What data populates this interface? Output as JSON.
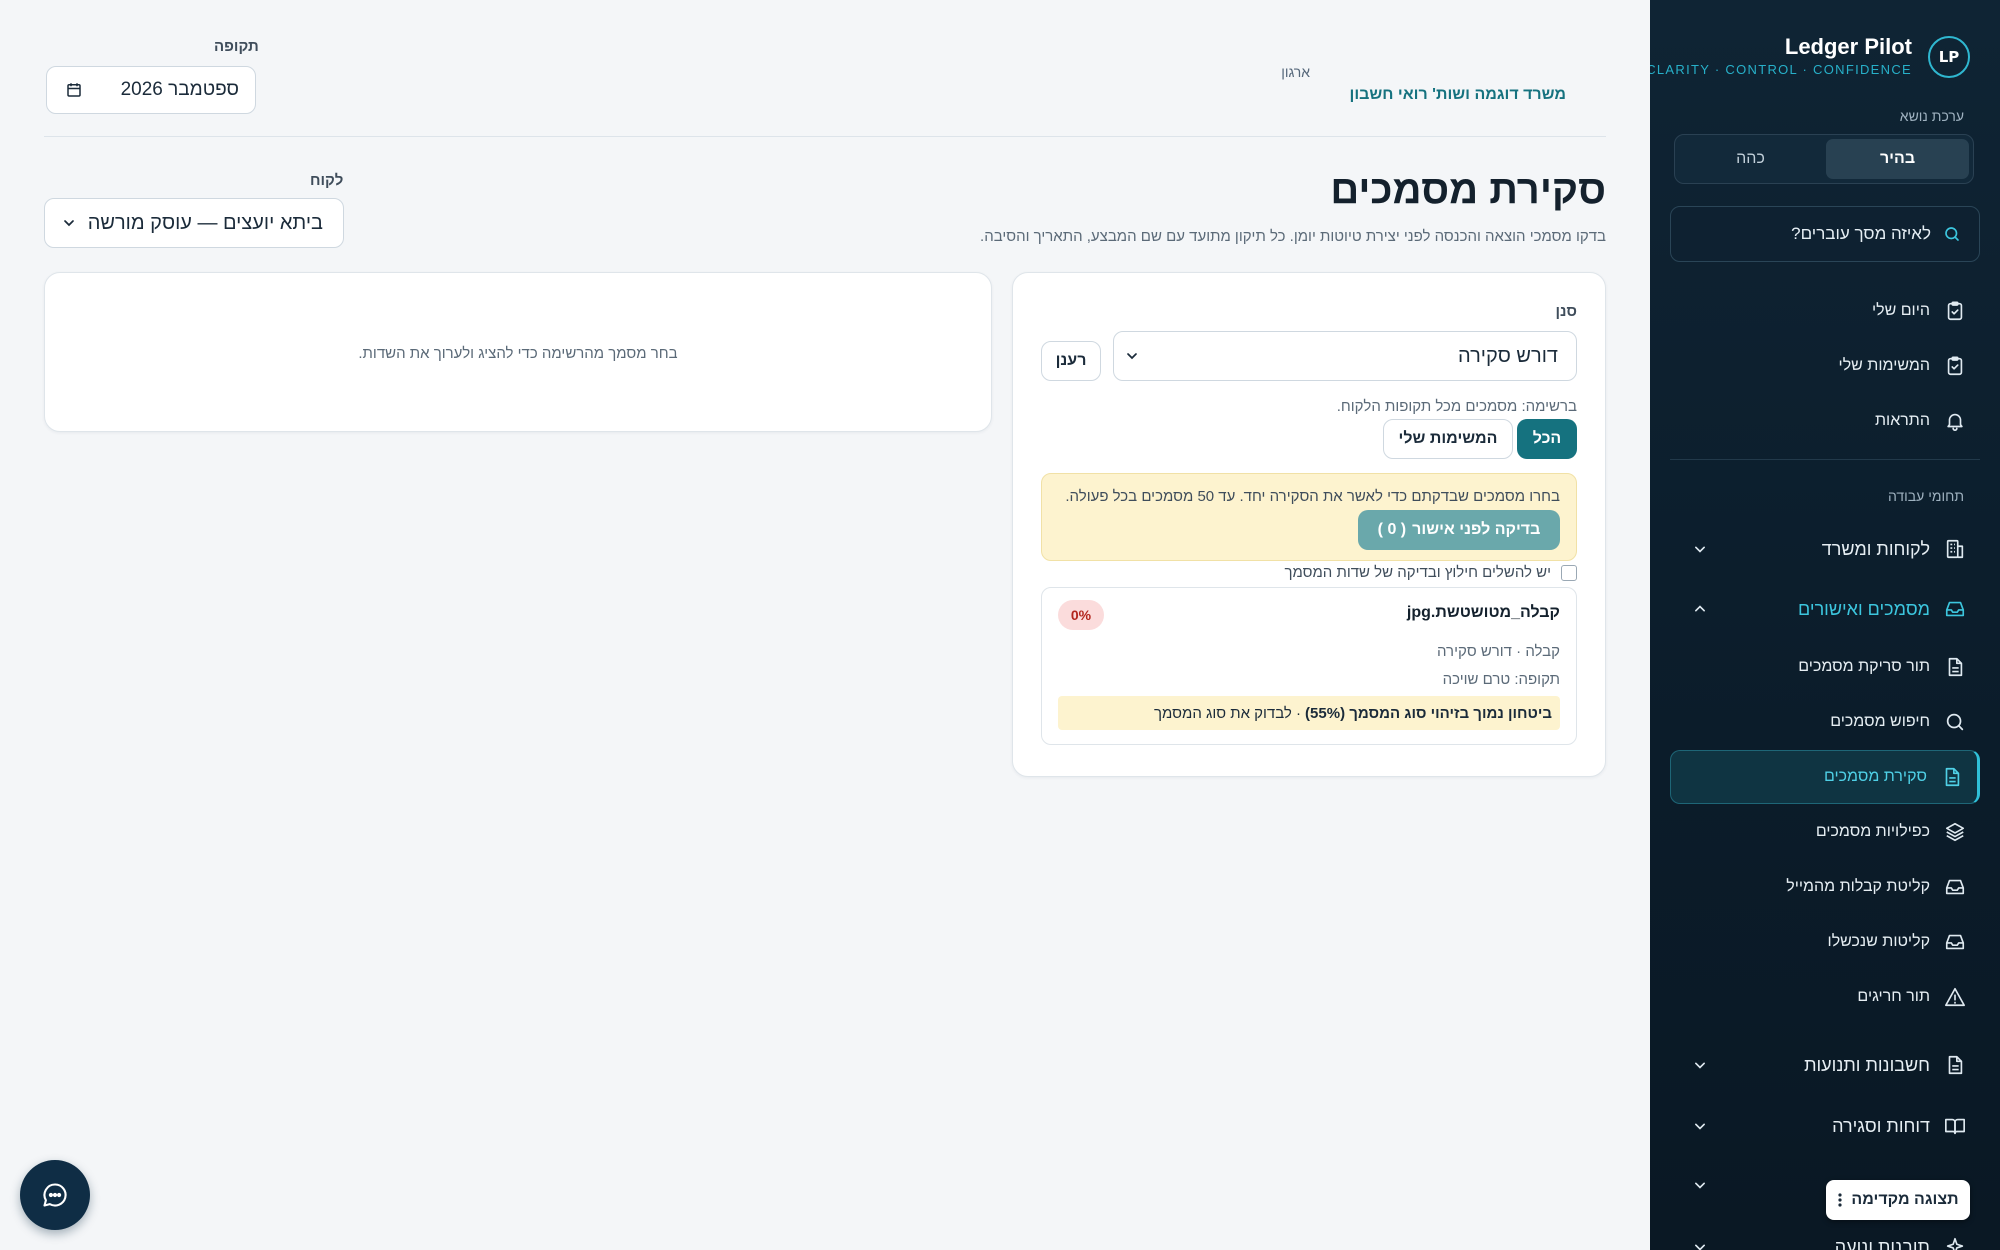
{
  "brand": {
    "name": "Ledger Pilot",
    "tagline": "CLARITY · CONTROL · CONFIDENCE",
    "logo_initials": "LP"
  },
  "theme": {
    "label": "ערכת נושא",
    "options": [
      "בהיר",
      "כהה"
    ],
    "selected": "בהיר"
  },
  "search": {
    "placeholder": "לאיזה מסך עוברים?",
    "value": ""
  },
  "nav_top": [
    {
      "label": "היום שלי",
      "icon": "clipboard-check-icon"
    },
    {
      "label": "המשימות שלי",
      "icon": "clipboard-check-icon"
    },
    {
      "label": "התראות",
      "icon": "bell-icon"
    }
  ],
  "work_areas": {
    "label": "תחומי עבודה",
    "groups": [
      {
        "label": "לקוחות ומשרד",
        "icon": "building-icon",
        "expanded": false
      },
      {
        "label": "מסמכים ואישורים",
        "icon": "inbox-icon",
        "expanded": true
      },
      {
        "label": "חשבונות ותנועות",
        "icon": "document-icon",
        "expanded": false
      },
      {
        "label": "דוחות וסגירה",
        "icon": "book-open-icon",
        "expanded": false
      },
      {
        "label": "תובנות ונועה",
        "icon": "sparkle-icon",
        "expanded": false
      }
    ],
    "documents_sub": [
      {
        "label": "תור סריקת מסמכים",
        "icon": "document-icon",
        "active": false
      },
      {
        "label": "חיפוש מסמכים",
        "icon": "search-icon",
        "active": false
      },
      {
        "label": "סקירת מסמכים",
        "icon": "document-icon",
        "active": true
      },
      {
        "label": "כפילויות מסמכים",
        "icon": "layers-icon",
        "active": false
      },
      {
        "label": "קליטת קבלות מהמייל",
        "icon": "inbox-icon",
        "active": false
      },
      {
        "label": "קליטות שנכשלו",
        "icon": "inbox-icon",
        "active": false
      },
      {
        "label": "תור חריגים",
        "icon": "warning-triangle-icon",
        "active": false
      }
    ]
  },
  "preview_button": "תצוגה מקדימה",
  "org": {
    "label": "ארגון",
    "name": "משרד דוגמה ושות' רואי חשבון"
  },
  "period": {
    "label": "תקופה",
    "value": "ספטמבר 2026"
  },
  "page": {
    "title": "סקירת מסמכים",
    "description": "בדקו מסמכי הוצאה והכנסה לפני יצירת טיוטות יומן. כל תיקון מתועד עם שם המבצע, התאריך והסיבה."
  },
  "client": {
    "label": "לקוח",
    "value": "ביתא יועצים — עוסק מורשה"
  },
  "detail_panel": {
    "empty_message": "בחר מסמך מהרשימה כדי להציג ולערוך את השדות."
  },
  "list_panel": {
    "filter_label": "סנן",
    "filter_value": "דורש סקירה",
    "refresh_label": "רענן",
    "list_note": "ברשימה: מסמכים מכל תקופות הלקוח.",
    "segments": [
      "הכל",
      "המשימות שלי"
    ],
    "selected_segment": "הכל",
    "approve_hint": "בחרו מסמכים שבדקתם כדי לאשר את הסקירה יחד. עד 50 מסמכים בכל פעולה.",
    "approve_button": "בדיקה לפני אישור",
    "approve_count": "( 0 )",
    "checkbox_label": "יש להשלים חילוץ ובדיקה של שדות המסמך",
    "document": {
      "file_name": "קבלה_מטושטשת.jpg",
      "confidence_badge": "0%",
      "meta_type": "קבלה · דורש סקירה",
      "meta_period": "תקופה: טרם שויכה",
      "warning_bold": "ביטחון נמוך בזיהוי סוג המסמך (55%)",
      "warning_rest": "· לבדוק את סוג המסמך"
    }
  },
  "colors": {
    "sidebar_bg": "#0f2434",
    "accent": "#15727f",
    "accent_bright": "#3cc6de",
    "warning_bg": "#fdf3cf",
    "danger_badge": "#fbdcdc"
  }
}
